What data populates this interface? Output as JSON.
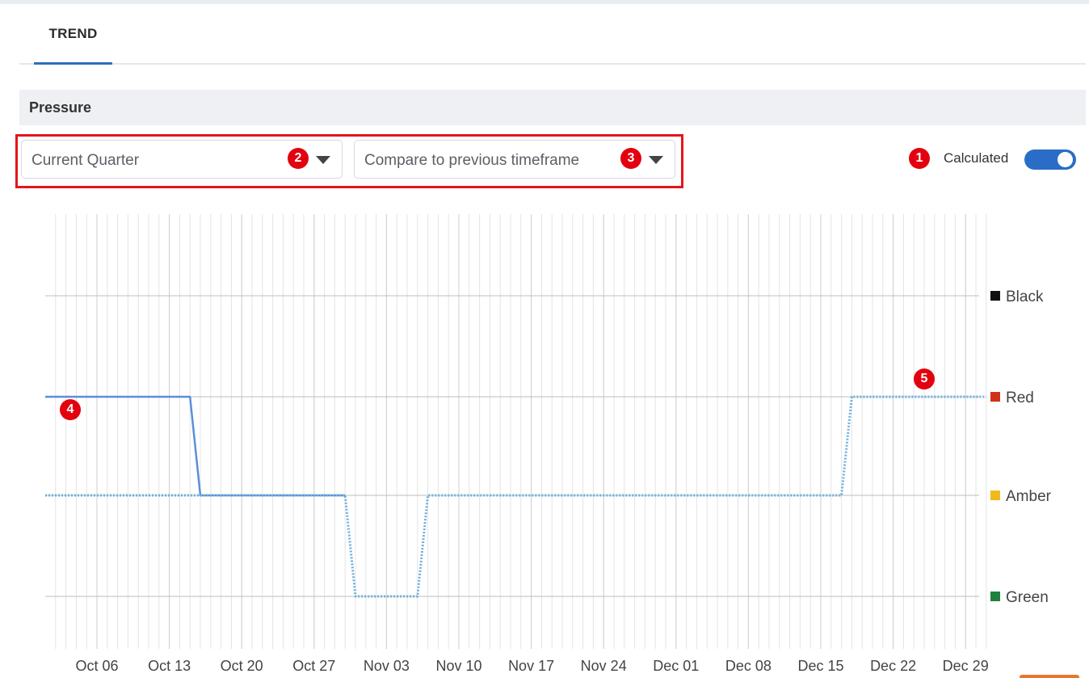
{
  "tabs": [
    {
      "label": "TREND",
      "active": true
    }
  ],
  "section": {
    "title": "Pressure"
  },
  "filters": {
    "timeframe": {
      "value": "Current Quarter"
    },
    "compare": {
      "value": "Compare to previous timeframe"
    }
  },
  "calculated": {
    "label": "Calculated",
    "on": true
  },
  "markers": [
    "1",
    "2",
    "3",
    "4",
    "5"
  ],
  "colors": {
    "accent": "#2a6dc7",
    "marker": "#e3000f",
    "line": "#5b8fd9",
    "dotted": "#6fb0dc"
  },
  "chart_data": {
    "type": "line",
    "x_ticks": [
      "Oct 06",
      "Oct 13",
      "Oct 20",
      "Oct 27",
      "Nov 03",
      "Nov 10",
      "Nov 17",
      "Nov 24",
      "Dec 01",
      "Dec 08",
      "Dec 15",
      "Dec 22",
      "Dec 29"
    ],
    "y_categories": [
      "Green",
      "Amber",
      "Red",
      "Black"
    ],
    "legend": [
      {
        "label": "Black",
        "color": "#111111"
      },
      {
        "label": "Red",
        "color": "#d0331a"
      },
      {
        "label": "Amber",
        "color": "#f2b91c"
      },
      {
        "label": "Green",
        "color": "#1f8040"
      }
    ],
    "xlim": [
      "Oct 01",
      "Dec 31"
    ],
    "grid": true,
    "legend_position": "right",
    "series": [
      {
        "style": "solid",
        "color": "#5b8fd9",
        "points": [
          [
            "Oct 01",
            "Red"
          ],
          [
            "Oct 15",
            "Red"
          ],
          [
            "Oct 16",
            "Amber"
          ],
          [
            "Oct 30",
            "Amber"
          ]
        ]
      },
      {
        "style": "dotted",
        "color": "#6fb0dc",
        "points": [
          [
            "Oct 01",
            "Amber"
          ],
          [
            "Oct 30",
            "Amber"
          ],
          [
            "Oct 31",
            "Green"
          ],
          [
            "Nov 06",
            "Green"
          ],
          [
            "Nov 07",
            "Amber"
          ],
          [
            "Dec 17",
            "Amber"
          ],
          [
            "Dec 18",
            "Red"
          ],
          [
            "Dec 31",
            "Red"
          ]
        ]
      }
    ]
  }
}
